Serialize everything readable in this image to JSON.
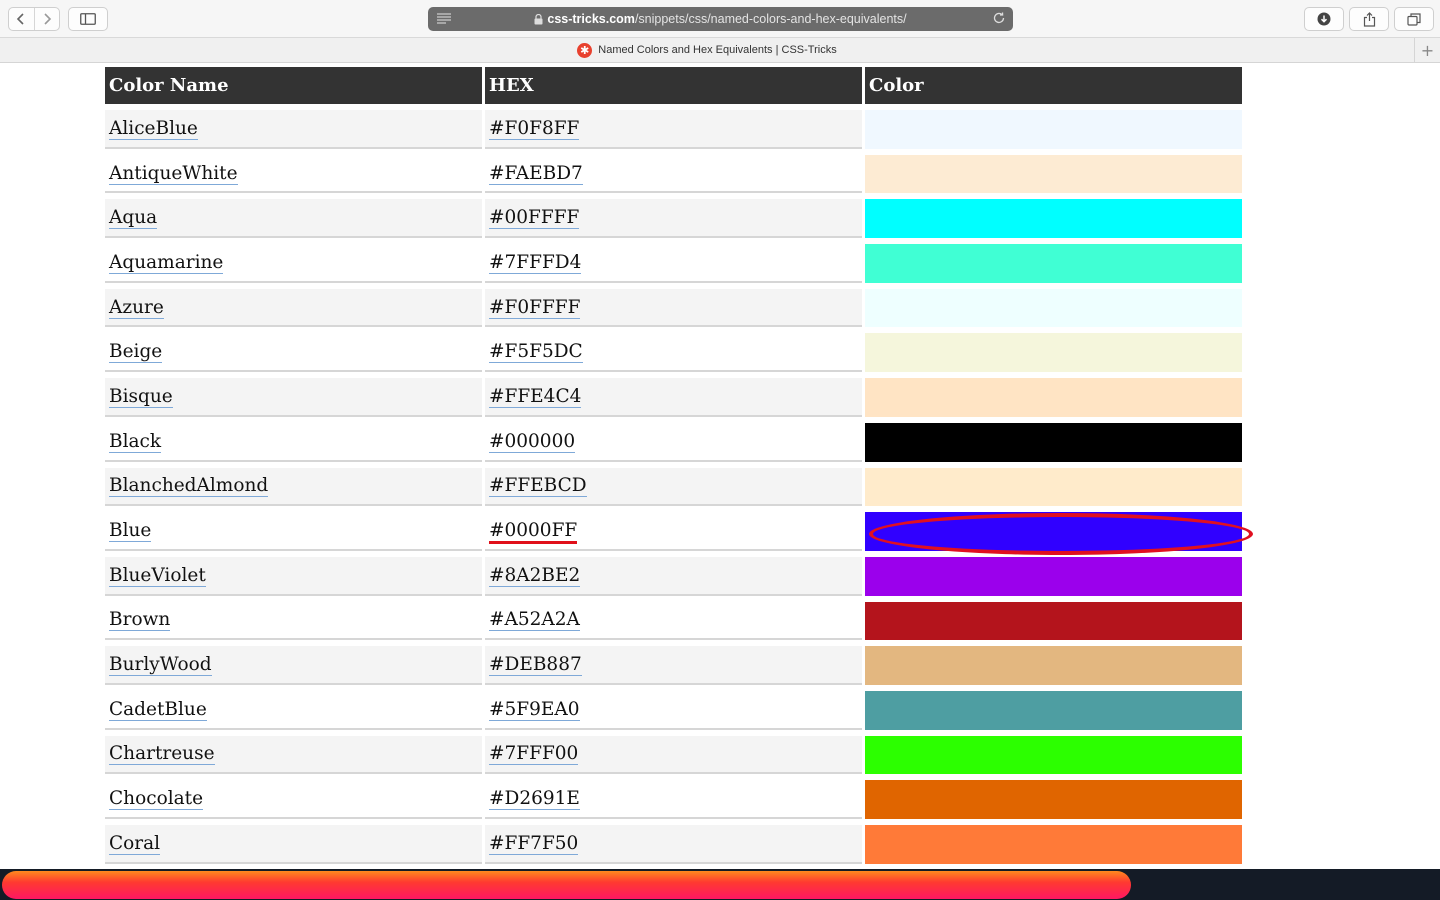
{
  "browser": {
    "url_host": "css-tricks.com",
    "url_path": "/snippets/css/named-colors-and-hex-equivalents/",
    "tab_title": "Named Colors and Hex Equivalents | CSS-Tricks",
    "icons": [
      "chevron-left-icon",
      "chevron-right-icon",
      "sidebar-icon",
      "reader-icon",
      "lock-icon",
      "reload-icon",
      "download-icon",
      "share-icon",
      "tabs-icon",
      "plus-icon"
    ]
  },
  "table": {
    "headers": [
      "Color Name",
      "HEX",
      "Color"
    ],
    "rows": [
      {
        "name": "AliceBlue",
        "hex": "#F0F8FF",
        "swatch": "#F0F8FF"
      },
      {
        "name": "AntiqueWhite",
        "hex": "#FAEBD7",
        "swatch": "#FDEBD3"
      },
      {
        "name": "Aqua",
        "hex": "#00FFFF",
        "swatch": "#00FFFF"
      },
      {
        "name": "Aquamarine",
        "hex": "#7FFFD4",
        "swatch": "#40FFD4"
      },
      {
        "name": "Azure",
        "hex": "#F0FFFF",
        "swatch": "#EEFFFF"
      },
      {
        "name": "Beige",
        "hex": "#F5F5DC",
        "swatch": "#F5F6DC"
      },
      {
        "name": "Bisque",
        "hex": "#FFE4C4",
        "swatch": "#FFE4C4"
      },
      {
        "name": "Black",
        "hex": "#000000",
        "swatch": "#000000"
      },
      {
        "name": "BlanchedAlmond",
        "hex": "#FFEBCD",
        "swatch": "#FFEBCB"
      },
      {
        "name": "Blue",
        "hex": "#0000FF",
        "swatch": "#3000FF",
        "marked": true
      },
      {
        "name": "BlueViolet",
        "hex": "#8A2BE2",
        "swatch": "#9B00EC"
      },
      {
        "name": "Brown",
        "hex": "#A52A2A",
        "swatch": "#B4141C"
      },
      {
        "name": "BurlyWood",
        "hex": "#DEB887",
        "swatch": "#E3B780"
      },
      {
        "name": "CadetBlue",
        "hex": "#5F9EA0",
        "swatch": "#4E9EA2"
      },
      {
        "name": "Chartreuse",
        "hex": "#7FFF00",
        "swatch": "#2CFF00"
      },
      {
        "name": "Chocolate",
        "hex": "#D2691E",
        "swatch": "#E06500"
      },
      {
        "name": "Coral",
        "hex": "#FF7F50",
        "swatch": "#FF7A38"
      }
    ]
  },
  "annotation_color": "#E0101A",
  "progress_gradient": [
    "#FF8A1E",
    "#FF1763"
  ]
}
